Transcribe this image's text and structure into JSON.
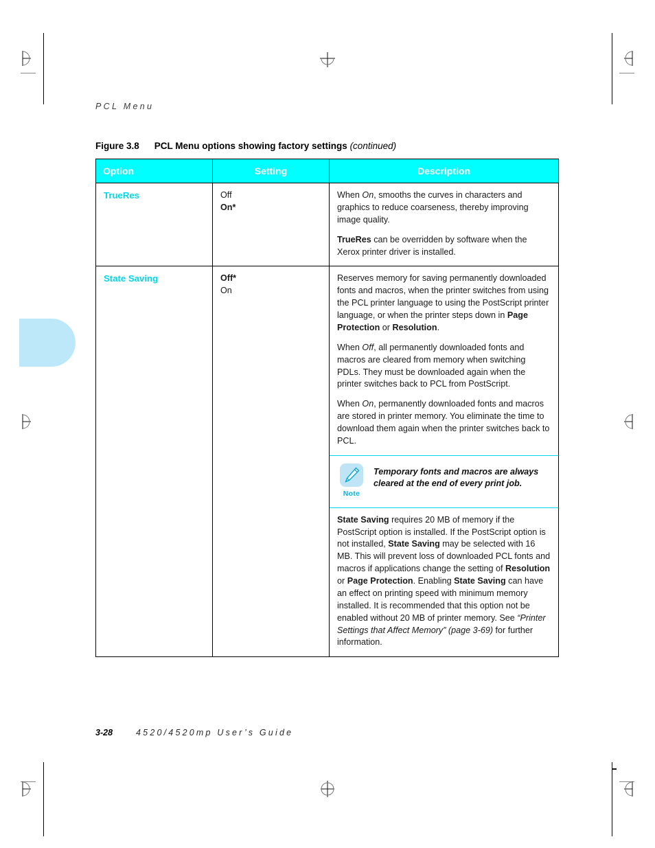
{
  "page": {
    "running_head": "PCL Menu",
    "figure_number": "Figure 3.8",
    "figure_title": "PCL Menu options showing factory settings",
    "figure_continued": "(continued)",
    "footer_page": "3-28",
    "footer_guide": "4520/4520mp User’s Guide",
    "accent_cyan": "#00FFFF",
    "accent_label_cyan": "#00D8E8",
    "tab_blue": "#BDE8F9"
  },
  "table": {
    "headers": {
      "option": "Option",
      "setting": "Setting",
      "description": "Description"
    },
    "rows": [
      {
        "option": "TrueRes",
        "settings": [
          {
            "text": "Off",
            "bold": false
          },
          {
            "text": "On*",
            "bold": true
          }
        ],
        "description_paragraphs": [
          "When <i>On</i>, smooths the curves in characters and graphics to reduce coarseness, thereby improving image quality.",
          "<b>TrueRes</b> can be overridden by software when the Xerox printer driver is installed."
        ]
      },
      {
        "option": "State Saving",
        "settings": [
          {
            "text": "Off*",
            "bold": true
          },
          {
            "text": "On",
            "bold": false
          }
        ],
        "description_paragraphs": [
          "Reserves memory for saving permanently downloaded fonts and macros, when the printer switches from using the PCL printer language to using the PostScript printer language, or when the printer steps down in <b>Page Protection</b> or <b>Resolution</b>.",
          "When <i>Off</i>, all permanently downloaded fonts and macros are cleared from memory when switching PDLs. They must be downloaded again when the printer switches back to PCL from PostScript.",
          "When <i>On</i>, permanently downloaded fonts and macros are stored in printer memory. You eliminate the time to download them again when the printer switches back to PCL."
        ],
        "note": {
          "label": "Note",
          "icon": "pencil-icon",
          "text": "Temporary fonts and macros are always cleared at the end of every print job."
        },
        "description_paragraphs_after": [
          "<b>State Saving</b> requires 20 MB of memory if the PostScript option is installed. If the PostScript option is not installed, <b>State Saving</b> may be selected with 16 MB. This will prevent loss of downloaded PCL fonts and macros if applications change the setting of <b>Resolution</b> or <b>Page Protection</b>. Enabling <b>State Saving</b> can have an effect on printing speed with minimum memory installed. It is recommended that this option not be enabled without 20 MB of printer memory. See <i>“Printer Settings that Affect Memory” (page 3-69)</i> for further information."
        ]
      }
    ]
  }
}
